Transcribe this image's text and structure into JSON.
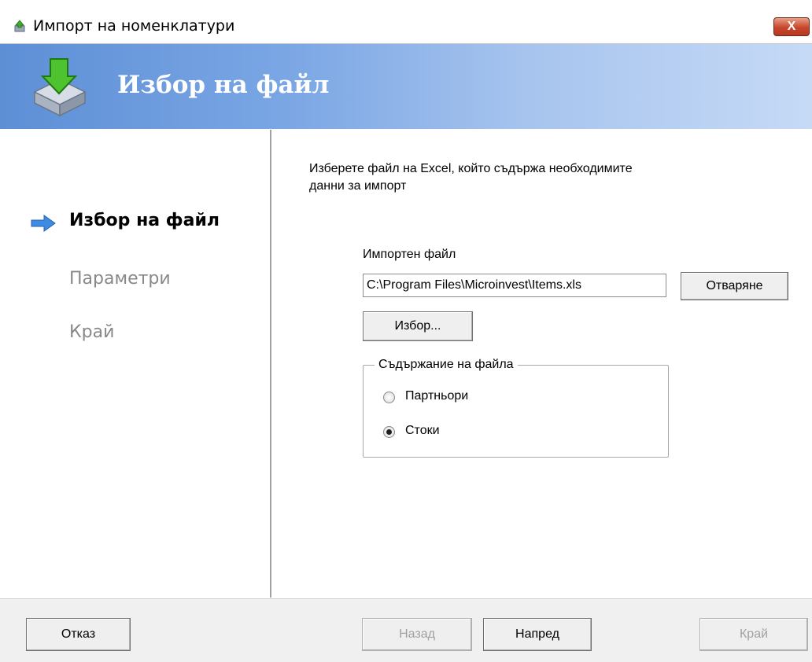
{
  "window": {
    "title": "Импорт на номенклатури",
    "close_glyph": "X"
  },
  "banner": {
    "title": "Избор на файл",
    "icon": "download-tray-icon"
  },
  "steps": [
    {
      "label": "Избор на файл",
      "state": "active"
    },
    {
      "label": "Параметри",
      "state": "inactive"
    },
    {
      "label": "Край",
      "state": "inactive"
    }
  ],
  "content": {
    "instruction": "Изберете файл на Excel, който съдържа необходимите данни за импорт",
    "file_label": "Импортен файл",
    "file_path": "C:\\Program Files\\Microinvest\\Items.xls",
    "open_button": "Отваряне",
    "browse_button": "Избор...",
    "group_label": "Съдържание на файла",
    "radio_options": [
      {
        "label": "Партньори",
        "checked": false
      },
      {
        "label": "Стоки",
        "checked": true
      }
    ]
  },
  "footer": {
    "cancel": "Отказ",
    "back": "Назад",
    "next": "Напред",
    "finish": "Край"
  },
  "colors": {
    "banner_start": "#5d8fd6",
    "banner_end": "#c6daf6",
    "close_button": "#c8452a",
    "disabled_text": "#a0a0a0"
  }
}
